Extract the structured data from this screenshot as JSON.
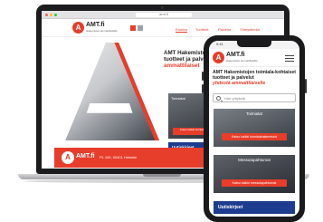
{
  "colors": {
    "brand_red": "#e73d2b",
    "navy": "#1d3b8f"
  },
  "browser": {
    "url": "amt.fi"
  },
  "site": {
    "brand": "AMT.fi",
    "tagline": "Hakemistot ammattilaisille",
    "nav": [
      "Etusivu",
      "Tuotteet",
      "Palvelut",
      "Yhteystiedot"
    ],
    "hero_title": "AMT Hakemistojen toimiala-kohtaiset tuotteet ja palvelut",
    "hero_title_accent": "ammattilaiset",
    "card_title": "Toimialat",
    "card_button": "Katso kaikki toimialat",
    "uutiskirjeet": "Uutiskirjeet",
    "footer_text": "PL 100, 00401 Helsinki"
  },
  "phone": {
    "time": "9:41",
    "brand": "AMT.fi",
    "tagline": "Hakemistot ammattilaisille",
    "title": "AMT Hakemistojen toimiala-kohtaiset tuotteet ja palvelut",
    "title_accent": "yhdestä ammattilaiselle",
    "search_placeholder": "Hae yrityksiä",
    "card1_title": "Toimialat",
    "card1_button": "Katso kaikki toimialahakemistot",
    "card2_title": "Messutapahtumat",
    "card2_button": "Katso kaikki messutapahtumat",
    "uutiskirjeet": "Uutiskirjeet"
  }
}
